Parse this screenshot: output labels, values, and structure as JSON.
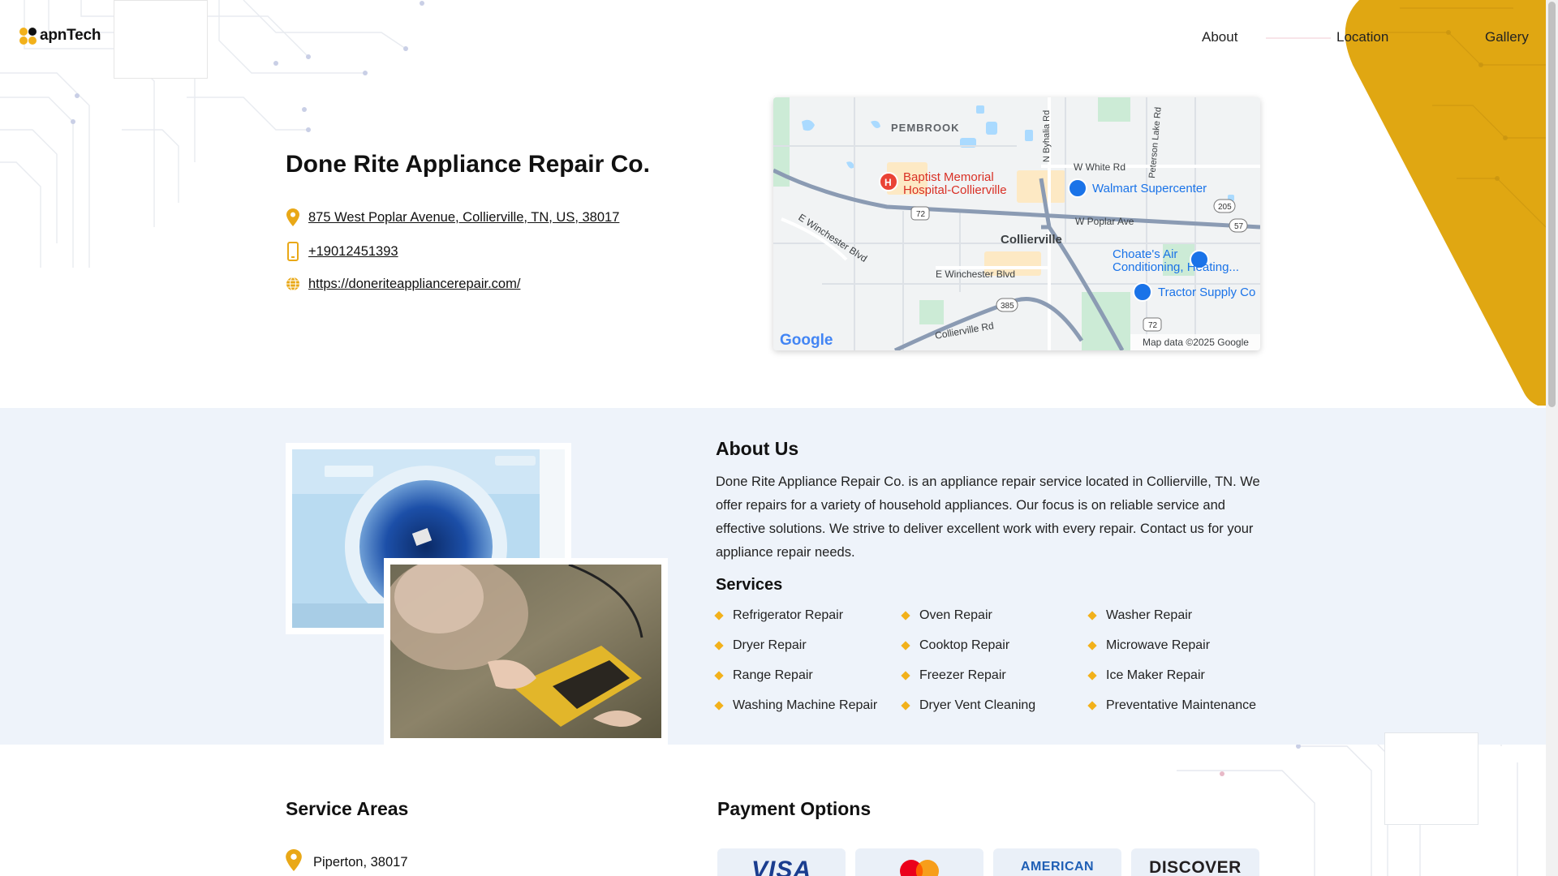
{
  "brand": {
    "logo_text": "apnTech"
  },
  "nav": {
    "items": [
      "About",
      "Location",
      "Gallery"
    ]
  },
  "business": {
    "name": "Done Rite Appliance Repair Co.",
    "address": "875 West Poplar Avenue, Collierville, TN, US, 38017",
    "phone": "+19012451393",
    "website": "https://doneriteappliancerepair.com/"
  },
  "map": {
    "labels": {
      "pembrook": "PEMBROOK",
      "hospital_line1": "Baptist Memorial",
      "hospital_line2": "Hospital-Collierville",
      "walmart": "Walmart Supercenter",
      "white_rd": "W White Rd",
      "poplar": "W Poplar Ave",
      "collierville": "Collierville",
      "winchester_w": "E Winchester Blvd",
      "winchester_e": "E Winchester Blvd",
      "choate_line1": "Choate's Air",
      "choate_line2": "Conditioning, Heating...",
      "tractor": "Tractor Supply Co",
      "byhalia": "N Byhalia Rd",
      "peterson": "Peterson Lake Rd",
      "collierville_rd": "Collierville Rd",
      "shield_72a": "72",
      "shield_72b": "72",
      "shield_205": "205",
      "shield_57": "57",
      "shield_385": "385",
      "google": "Google",
      "attribution": "Map data ©2025 Google"
    }
  },
  "about": {
    "title": "About Us",
    "text": "Done Rite Appliance Repair Co. is an appliance repair service located in Collierville, TN. We offer repairs for a variety of household appliances. Our focus is on reliable service and effective solutions. We strive to deliver excellent work with every repair. Contact us for your appliance repair needs."
  },
  "services": {
    "title": "Services",
    "items": [
      "Refrigerator Repair",
      "Oven Repair",
      "Washer Repair",
      "Dryer Repair",
      "Cooktop Repair",
      "Microwave Repair",
      "Range Repair",
      "Freezer Repair",
      "Ice Maker Repair",
      "Washing Machine Repair",
      "Dryer Vent Cleaning",
      "Preventative Maintenance"
    ]
  },
  "service_areas": {
    "title": "Service Areas",
    "items": [
      "Piperton, 38017"
    ]
  },
  "payment": {
    "title": "Payment Options",
    "cards": [
      "VISA",
      "",
      "AMERICAN",
      "DISCOVER"
    ]
  },
  "colors": {
    "accent": "#e0a712",
    "pin": "#e9a817",
    "band": "#eef3fa",
    "visa": "#1a3d8f"
  }
}
